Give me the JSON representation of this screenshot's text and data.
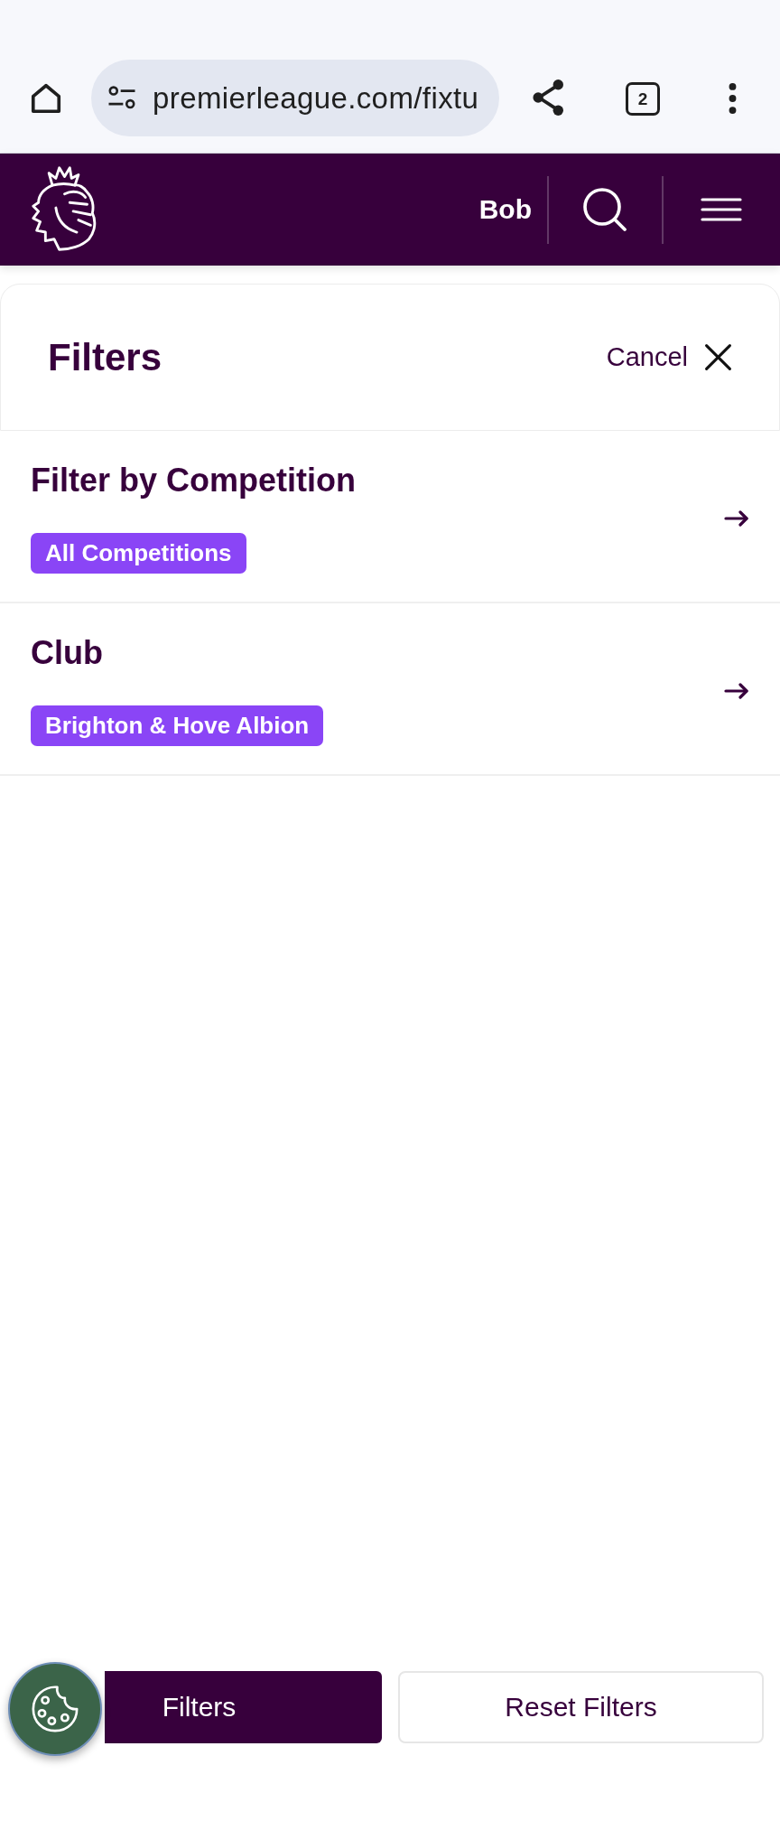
{
  "browser": {
    "url": "premierleague.com/fixtu",
    "tab_count": "2"
  },
  "header": {
    "user": "Bob"
  },
  "panel": {
    "title": "Filters",
    "cancel": "Cancel"
  },
  "filters": [
    {
      "label": "Filter by Competition",
      "value": "All Competitions"
    },
    {
      "label": "Club",
      "value": "Brighton & Hove Albion"
    }
  ],
  "actions": [
    {
      "label": "Filters",
      "kind": "primary"
    },
    {
      "label": "Reset Filters",
      "kind": "secondary"
    }
  ]
}
